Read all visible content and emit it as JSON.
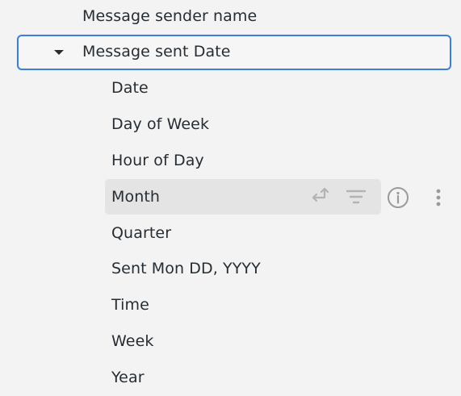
{
  "field_picker": {
    "parent_field": {
      "label": "Message sender name"
    },
    "group": {
      "label": "Message sent Date",
      "expanded": true,
      "caret_icon": "caret-down-icon"
    },
    "children": [
      {
        "label": "Date"
      },
      {
        "label": "Day of Week"
      },
      {
        "label": "Hour of Day"
      },
      {
        "label": "Month",
        "hovered": true
      },
      {
        "label": "Quarter"
      },
      {
        "label": "Sent Mon DD, YYYY"
      },
      {
        "label": "Time"
      },
      {
        "label": "Week"
      },
      {
        "label": "Year"
      }
    ],
    "hover_actions": {
      "pivot_icon": "pivot-icon",
      "filter_icon": "filter-icon",
      "info_icon": "info-icon",
      "more_icon": "more-vertical-icon"
    },
    "colors": {
      "focus_border": "#3f7ed5",
      "hover_bg": "#e4e4e4",
      "icon_muted": "#b3b3b3",
      "background": "#f3f3f3"
    }
  }
}
